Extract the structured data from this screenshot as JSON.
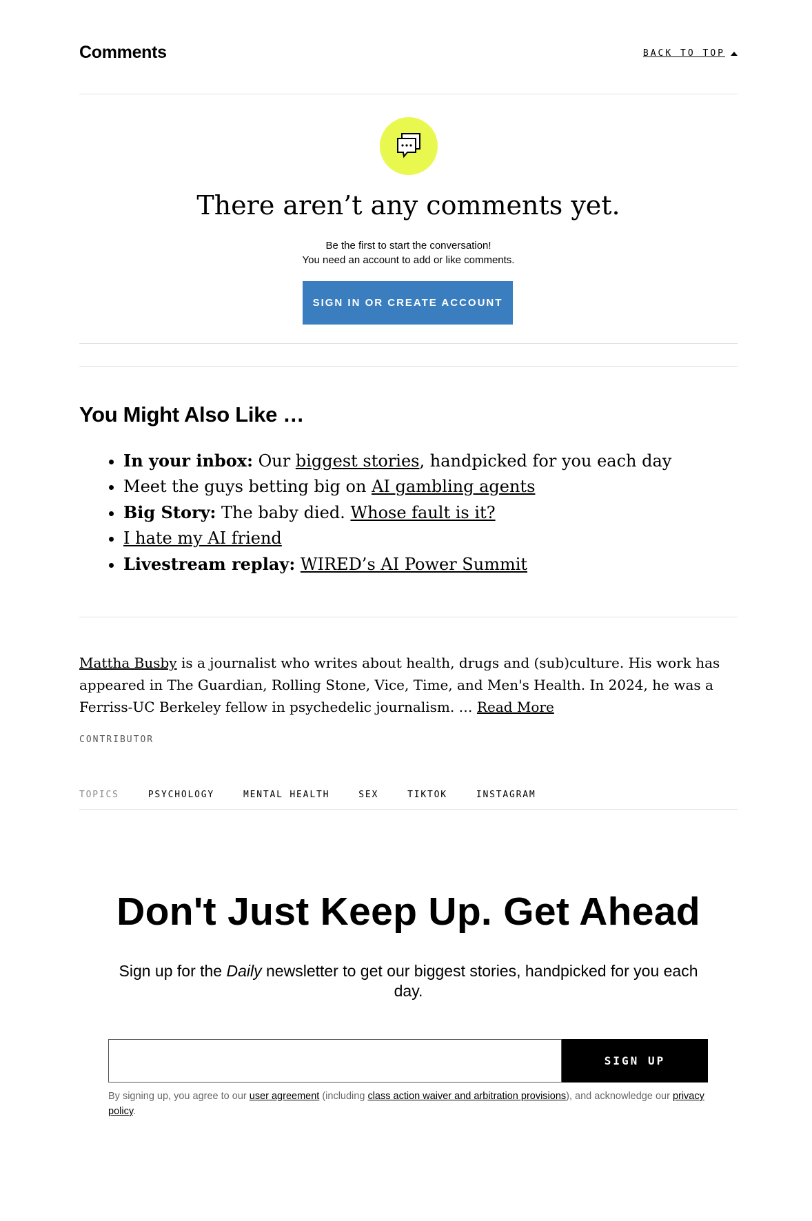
{
  "comments": {
    "title": "Comments",
    "back_to_top": "BACK TO TOP",
    "empty_title": "There aren’t any comments yet.",
    "empty_line1": "Be the first to start the conversation!",
    "empty_line2": "You need an account to add or like comments.",
    "signin_label": "SIGN IN OR CREATE ACCOUNT",
    "icon": "comment-bubbles-icon",
    "icon_bg": "#e9f84f",
    "button_color": "#3a7ebf"
  },
  "also_like": {
    "title": "You Might Also Like …",
    "items": [
      {
        "bold": "In your inbox:",
        "pre": " Our ",
        "link": "biggest stories",
        "post": ", handpicked for you each day"
      },
      {
        "bold": "",
        "pre": "Meet the guys betting big on ",
        "link": "AI gambling agents",
        "post": ""
      },
      {
        "bold": "Big Story:",
        "pre": " The baby died. ",
        "link": "Whose fault is it?",
        "post": ""
      },
      {
        "bold": "",
        "pre": "",
        "link": "I hate my AI friend",
        "post": ""
      },
      {
        "bold": "Livestream replay:",
        "pre": " ",
        "link": "WIRED’s AI Power Summit",
        "post": ""
      }
    ]
  },
  "author": {
    "name": "Mattha Busby",
    "bio": " is a journalist who writes about health, drugs and (sub)culture. His work has appeared in The Guardian, Rolling Stone, Vice, Time, and Men's Health. In 2024, he was a Ferriss-UC Berkeley fellow in psychedelic journalism. … ",
    "read_more": "Read More",
    "role": "CONTRIBUTOR"
  },
  "topics": {
    "label": "TOPICS",
    "items": [
      "PSYCHOLOGY",
      "MENTAL HEALTH",
      "SEX",
      "TIKTOK",
      "INSTAGRAM"
    ]
  },
  "newsletter": {
    "title": "Don't Just Keep Up. Get Ahead",
    "sub_pre": "Sign up for the ",
    "sub_em": "Daily",
    "sub_post": " newsletter to get our biggest stories, handpicked for you each day.",
    "email_value": "",
    "signup_label": "SIGN UP",
    "legal_1": "By signing up, you agree to our ",
    "legal_link1": "user agreement",
    "legal_2": " (including ",
    "legal_link2": "class action waiver and arbitration provisions",
    "legal_3": "), and acknowledge our ",
    "legal_link3": "privacy policy",
    "legal_4": "."
  }
}
